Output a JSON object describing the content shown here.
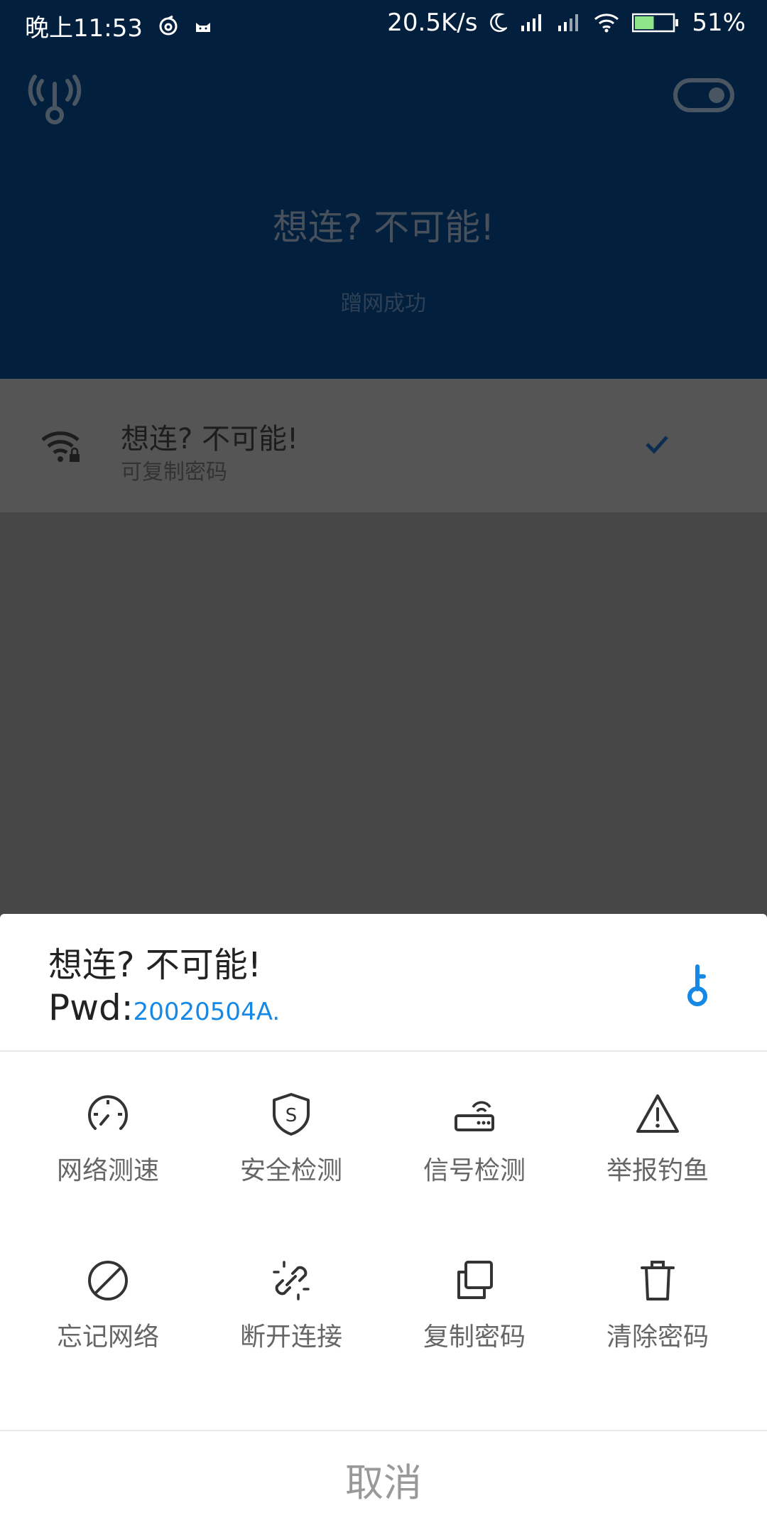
{
  "status_bar": {
    "time": "晚上11:53",
    "net_speed": "20.5K/s",
    "battery": "51%",
    "battery_level": 0.51
  },
  "header": {
    "ssid": "想连? 不可能!",
    "status": "蹭网成功",
    "toggle_on": true
  },
  "network_item": {
    "name": "想连? 不可能!",
    "subtitle": "可复制密码",
    "connected": true
  },
  "sheet": {
    "title": "想连? 不可能!",
    "pwd_label": "Pwd:",
    "pwd_value": "20020504A.",
    "actions": [
      {
        "label": "网络测速",
        "icon": "speedometer-icon"
      },
      {
        "label": "安全检测",
        "icon": "shield-s-icon"
      },
      {
        "label": "信号检测",
        "icon": "router-icon"
      },
      {
        "label": "举报钓鱼",
        "icon": "warning-icon"
      },
      {
        "label": "忘记网络",
        "icon": "forbidden-icon"
      },
      {
        "label": "断开连接",
        "icon": "broken-link-icon"
      },
      {
        "label": "复制密码",
        "icon": "copy-icon"
      },
      {
        "label": "清除密码",
        "icon": "trash-icon"
      }
    ],
    "cancel": "取消"
  },
  "colors": {
    "header_bg": "#021f3d",
    "accent": "#1688e6",
    "overlay": "#474747"
  }
}
